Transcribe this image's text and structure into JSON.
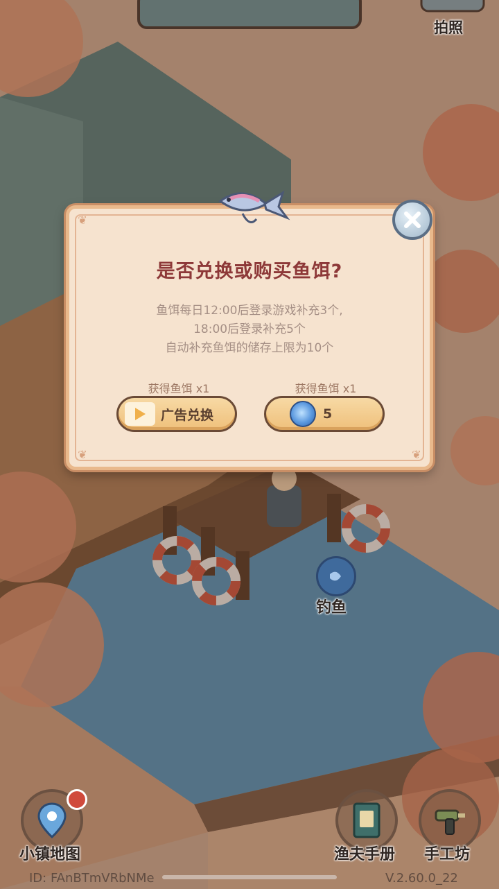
{
  "topbar": {
    "photo_label": "拍照"
  },
  "dialog": {
    "title": "是否兑换或购买鱼饵?",
    "desc_lines": [
      "鱼饵每日12:00后登录游戏补充3个,",
      "18:00后登录补充5个",
      "自动补充鱼饵的储存上限为10个"
    ],
    "left_reward": "获得鱼饵 x1",
    "right_reward": "获得鱼饵 x1",
    "ad_button_label": "广告兑换",
    "buy_button_value": "5"
  },
  "scene": {
    "fishing_label": "钓鱼"
  },
  "bottom": {
    "town_map": "小镇地图",
    "fisher_manual": "渔夫手册",
    "workshop": "手工坊",
    "id_text": "ID: FAnBTmVRbNMe",
    "version_text": "V.2.60.0_22"
  },
  "colors": {
    "title": "#8d3838",
    "dialog_bg": "#f6e3cf",
    "button": "#efc07b"
  }
}
